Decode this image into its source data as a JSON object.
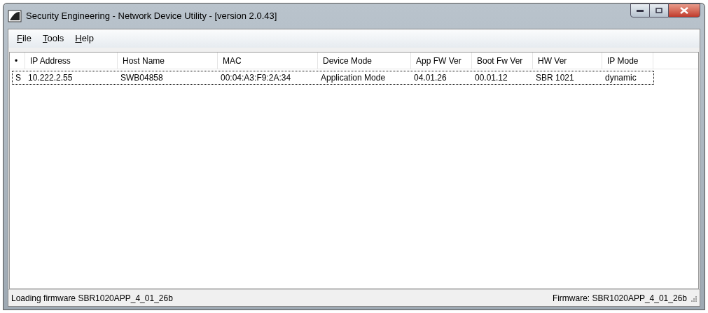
{
  "window": {
    "title": "Security Engineering - Network Device Utility - [version 2.0.43]"
  },
  "menu": [
    "File",
    "Tools",
    "Help"
  ],
  "table": {
    "columns": [
      "•",
      "IP Address",
      "Host Name",
      "MAC",
      "Device Mode",
      "App FW Ver",
      "Boot Fw Ver",
      "HW Ver",
      "IP Mode"
    ],
    "rows": [
      {
        "selected": true,
        "cells": [
          "S",
          "10.222.2.55",
          "SWB04858",
          "00:04:A3:F9:2A:34",
          "Application Mode",
          "04.01.26",
          "00.01.12",
          "SBR 1021",
          "dynamic"
        ]
      }
    ]
  },
  "status_bar": {
    "left": "Loading firmware SBR1020APP_4_01_26b",
    "right": "Firmware: SBR1020APP_4_01_26b"
  }
}
